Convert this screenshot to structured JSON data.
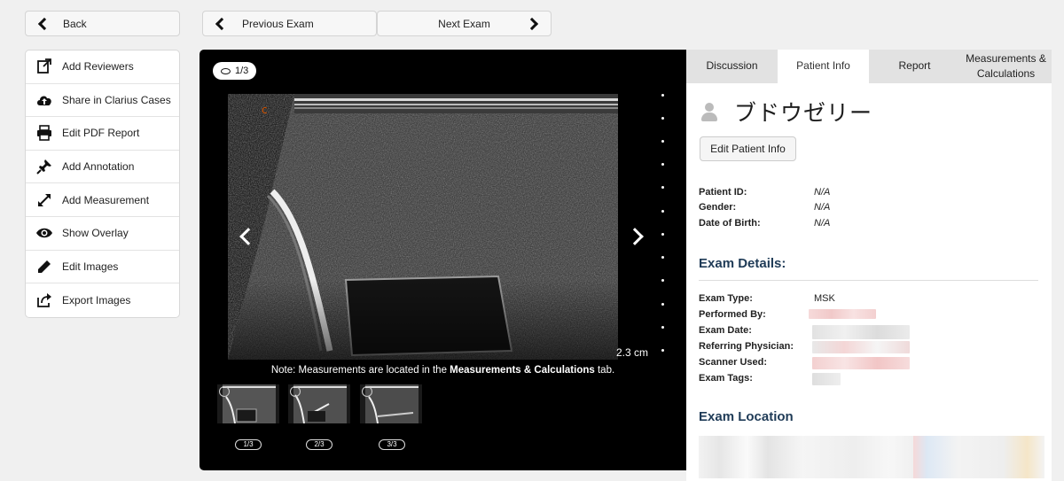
{
  "nav": {
    "back_label": "Back",
    "prev_label": "Previous Exam",
    "next_label": "Next Exam"
  },
  "menu": [
    {
      "label": "Add Reviewers",
      "icon": "add-reviewers-icon"
    },
    {
      "label": "Share in Clarius Cases",
      "icon": "cloud-upload-icon"
    },
    {
      "label": "Edit PDF Report",
      "icon": "printer-icon"
    },
    {
      "label": "Add Annotation",
      "icon": "pushpin-icon"
    },
    {
      "label": "Add Measurement",
      "icon": "resize-arrows-icon"
    },
    {
      "label": "Show Overlay",
      "icon": "eye-icon"
    },
    {
      "label": "Edit Images",
      "icon": "pencil-icon"
    },
    {
      "label": "Export Images",
      "icon": "export-icon"
    }
  ],
  "viewer": {
    "image_counter": "1/3",
    "depth_scale": "2.3 cm",
    "note_prefix": "Note: Measurements are located in the ",
    "note_bold": "Measurements & Calculations",
    "note_suffix": " tab.",
    "thumbnails": [
      "1/3",
      "2/3",
      "3/3"
    ]
  },
  "tabs": [
    {
      "label": "Discussion",
      "active": false
    },
    {
      "label": "Patient Info",
      "active": true
    },
    {
      "label": "Report",
      "active": false
    },
    {
      "label": "Measurements & Calculations",
      "active": false
    }
  ],
  "patient": {
    "name": "ブドウゼリー",
    "edit_label": "Edit Patient Info",
    "fields": [
      {
        "key": "Patient ID:",
        "value": "N/A"
      },
      {
        "key": "Gender:",
        "value": "N/A"
      },
      {
        "key": "Date of Birth:",
        "value": "N/A"
      }
    ]
  },
  "exam": {
    "title": "Exam Details:",
    "type_key": "Exam Type:",
    "type_value": "MSK",
    "performed_key": "Performed By:",
    "date_key": "Exam Date:",
    "physician_key": "Referring Physician:",
    "scanner_key": "Scanner Used:",
    "tags_key": "Exam Tags:"
  },
  "location": {
    "title": "Exam Location"
  },
  "colors": {
    "accent_title": "#1f3b57",
    "tab_inactive": "#e2e2e2",
    "viewer_bg": "#000000"
  }
}
